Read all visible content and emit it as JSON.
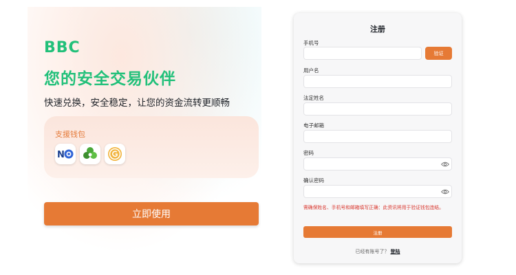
{
  "hero": {
    "brand": "BBC",
    "headline": "您的安全交易伙伴",
    "tagline": "快速兑换，安全稳定，让您的资金流转更顺畅"
  },
  "wallets": {
    "title": "支援钱包",
    "icons": [
      "nobi-wallet-icon",
      "clover-wallet-icon",
      "gold-coin-wallet-icon"
    ]
  },
  "cta": {
    "label": "立即使用"
  },
  "register": {
    "title": "注册",
    "phone_label": "手机号",
    "phone_value": "",
    "verify_label": "验证",
    "username_label": "用户名",
    "username_value": "",
    "legal_name_label": "法定姓名",
    "legal_name_value": "",
    "email_label": "电子邮箱",
    "email_value": "",
    "password_label": "密码",
    "password_value": "",
    "confirm_label": "确认密码",
    "confirm_value": "",
    "warning": "需确保姓名、手机号和邮箱填写正确：此资讯将用于验证钱包连结。",
    "submit_label": "注册",
    "have_account": "已经有账号了？",
    "login_label": "登陆"
  },
  "colors": {
    "accent": "#e67a35",
    "brand_green": "#22c07a",
    "warning_red": "#d9382f"
  }
}
